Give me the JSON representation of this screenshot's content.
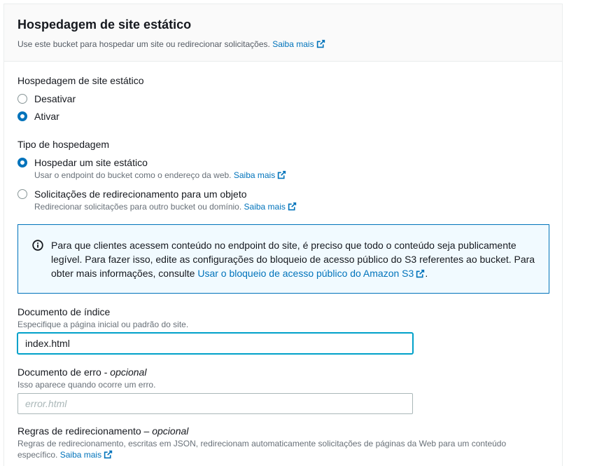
{
  "section": {
    "title": "Hospedagem de site estático",
    "description": "Use este bucket para hospedar um site ou redirecionar solicitações.",
    "learn_more": "Saiba mais"
  },
  "hosting": {
    "label": "Hospedagem de site estático",
    "options": [
      {
        "label": "Desativar",
        "checked": false
      },
      {
        "label": "Ativar",
        "checked": true
      }
    ]
  },
  "hosting_type": {
    "label": "Tipo de hospedagem",
    "options": [
      {
        "label": "Hospedar um site estático",
        "description": "Usar o endpoint do bucket como o endereço da web.",
        "learn_more": "Saiba mais",
        "checked": true
      },
      {
        "label": "Solicitações de redirecionamento para um objeto",
        "description": "Redirecionar solicitações para outro bucket ou domínio.",
        "learn_more": "Saiba mais",
        "checked": false
      }
    ]
  },
  "info": {
    "text": "Para que clientes acessem conteúdo no endpoint do site, é preciso que todo o conteúdo seja publicamente legível. Para fazer isso, edite as configurações do bloqueio de acesso público do S3 referentes ao bucket. Para obter mais informações, consulte",
    "link": "Usar o bloqueio de acesso público do Amazon S3",
    "suffix": "."
  },
  "index_document": {
    "label": "Documento de índice",
    "description": "Especifique a página inicial ou padrão do site.",
    "value": "index.html"
  },
  "error_document": {
    "label": "Documento de erro -",
    "optional": "opcional",
    "description": "Isso aparece quando ocorre um erro.",
    "placeholder": "error.html"
  },
  "redirect_rules": {
    "label": "Regras de redirecionamento –",
    "optional": "opcional",
    "description": "Regras de redirecionamento, escritas em JSON, redirecionam automaticamente solicitações de páginas da Web para um conteúdo específico.",
    "learn_more": "Saiba mais"
  },
  "colors": {
    "accent": "#0073bb",
    "focus": "#00a1c9",
    "info_bg": "#f1faff"
  }
}
